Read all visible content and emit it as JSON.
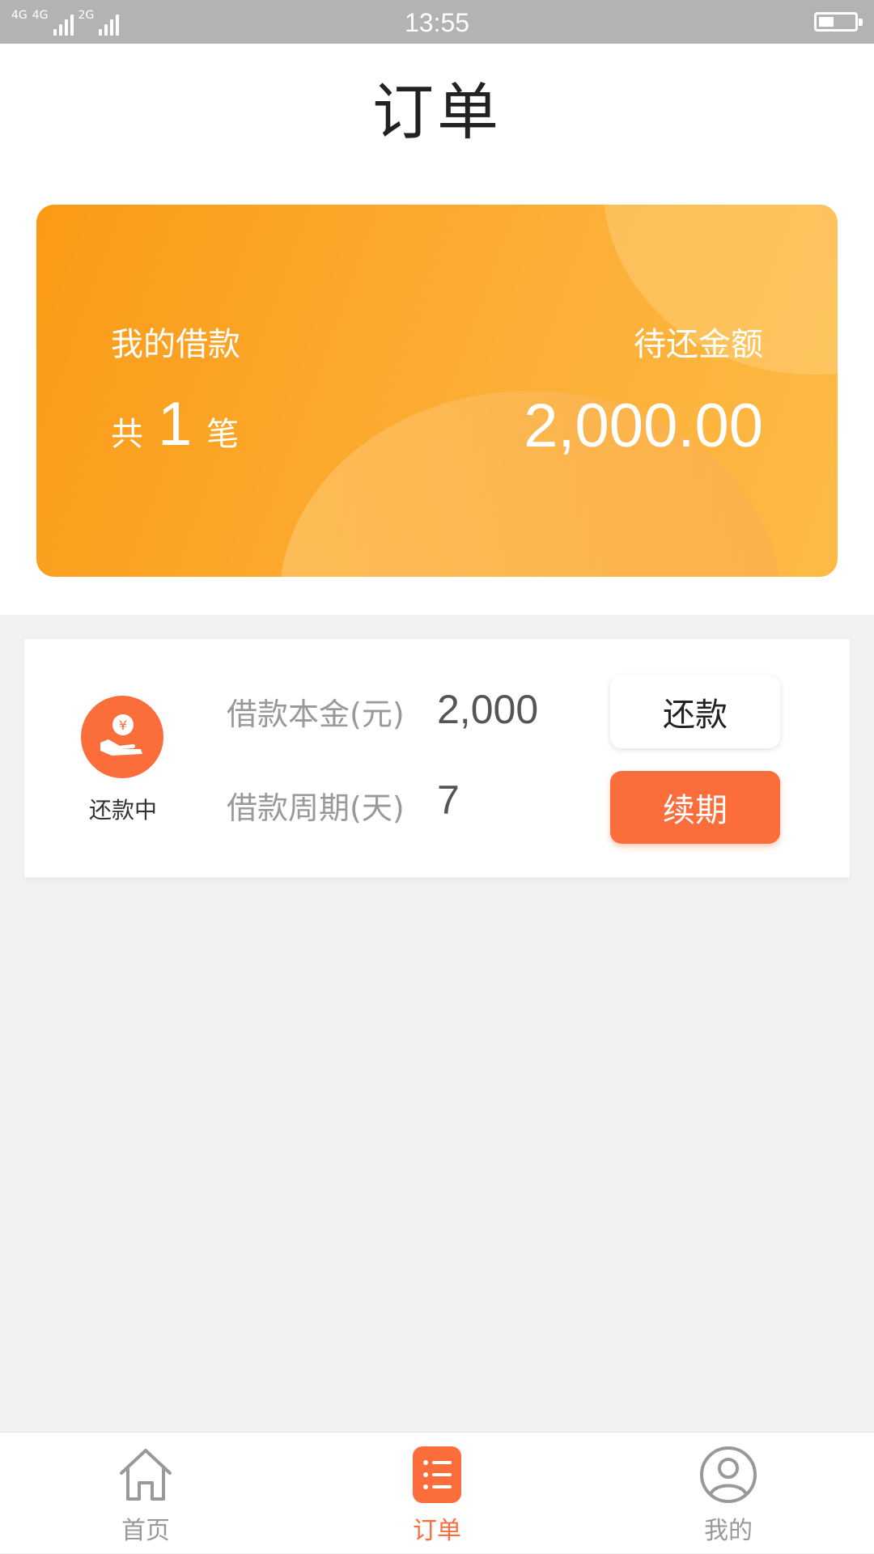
{
  "status_bar": {
    "network_1": "4G",
    "network_2": "4G",
    "network_3": "2G",
    "time": "13:55"
  },
  "header": {
    "title": "订单"
  },
  "summary": {
    "my_loans_label": "我的借款",
    "count_prefix": "共",
    "count": "1",
    "count_suffix": "笔",
    "pending_amount_label": "待还金额",
    "pending_amount": "2,000.00"
  },
  "order": {
    "status": "还款中",
    "principal_label": "借款本金(元)",
    "principal_value": "2,000",
    "period_label": "借款周期(天)",
    "period_value": "7",
    "repay_button": "还款",
    "renew_button": "续期"
  },
  "tabs": [
    {
      "label": "首页",
      "icon": "home-icon",
      "active": false
    },
    {
      "label": "订单",
      "icon": "list-icon",
      "active": true
    },
    {
      "label": "我的",
      "icon": "user-icon",
      "active": false
    }
  ],
  "colors": {
    "accent": "#fb6d3b",
    "card_gradient_start": "#fb9a16",
    "card_gradient_end": "#fdbb45"
  }
}
